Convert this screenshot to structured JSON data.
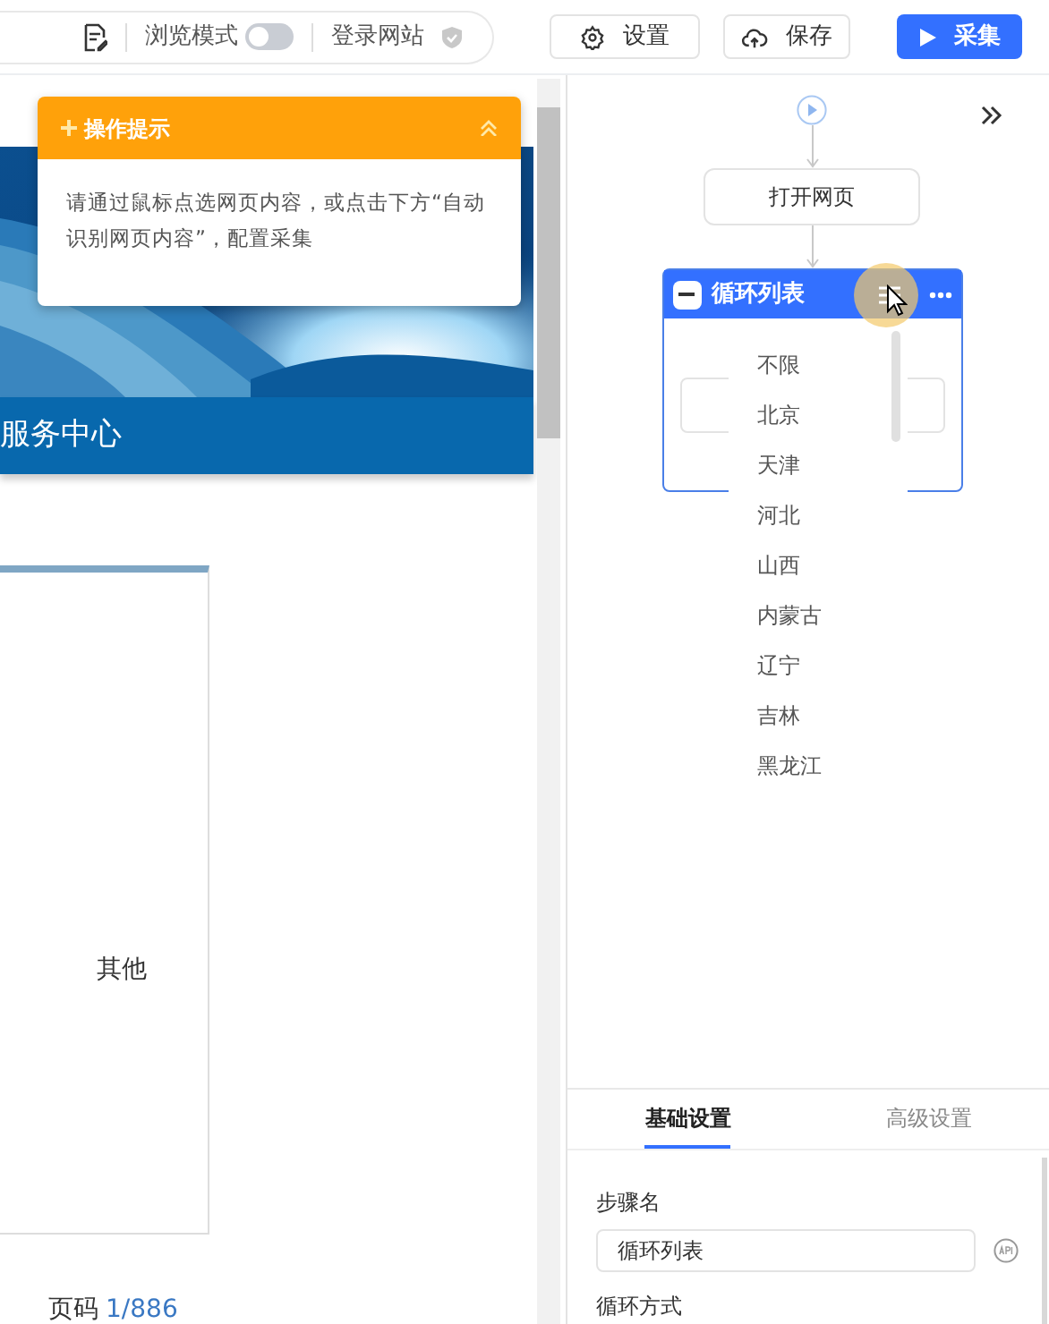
{
  "toolbar": {
    "browse_mode": {
      "label": "浏览模式",
      "on": false
    },
    "login_site": "登录网站",
    "buttons": [
      {
        "label": "设置",
        "kind": "settings"
      },
      {
        "label": "保存",
        "kind": "save"
      },
      {
        "label": "采集",
        "kind": "run"
      }
    ]
  },
  "webpage": {
    "banner_title": "服务中心",
    "side_box_text": "其他",
    "pagination": {
      "label": "页码",
      "value": "1/886"
    }
  },
  "tip": {
    "title": "操作提示",
    "body": "请通过鼠标点选网页内容，或点击下方“自动识别网页内容”，配置采集",
    "expanded": true
  },
  "workflow": {
    "steps": [
      {
        "kind": "step",
        "label": "打开网页"
      },
      {
        "kind": "loop",
        "label": "循环列表",
        "expanded": true
      }
    ]
  },
  "dropdown": {
    "items": [
      "不限",
      "北京",
      "天津",
      "河北",
      "山西",
      "内蒙古",
      "辽宁",
      "吉林",
      "黑龙江"
    ]
  },
  "settings": {
    "tabs": [
      {
        "label": "基础设置",
        "selected": true
      },
      {
        "label": "高级设置",
        "selected": false
      }
    ],
    "fields": [
      {
        "label": "步骤名",
        "value": "循环列表"
      }
    ],
    "next_label": "循环方式"
  }
}
